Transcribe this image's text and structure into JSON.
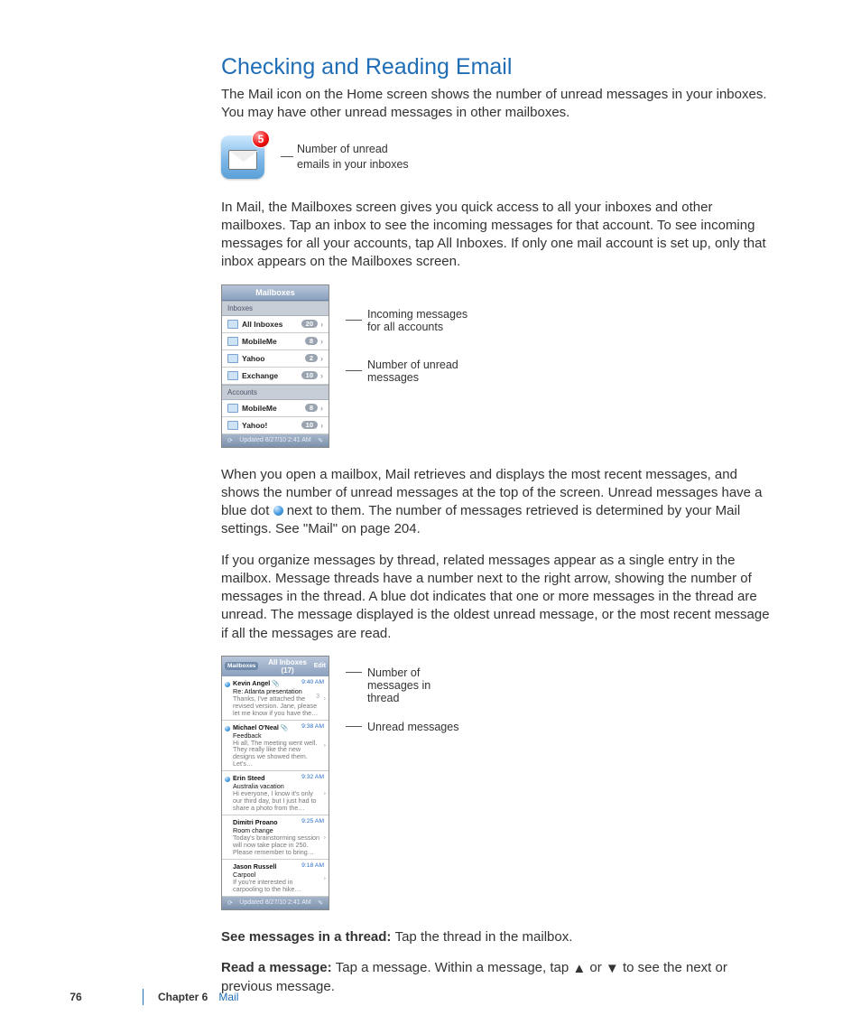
{
  "section": {
    "title": "Checking and Reading Email"
  },
  "paragraphs": {
    "p1": "The Mail icon on the Home screen shows the number of unread messages in your inboxes. You may have other unread messages in other mailboxes.",
    "iconCaption1": "Number of unread",
    "iconCaption2": "emails in your inboxes",
    "badge": "5",
    "p2": "In Mail, the Mailboxes screen gives you quick access to all your inboxes and other mailboxes. Tap an inbox to see the incoming messages for that account. To see incoming messages for all your accounts, tap All Inboxes. If only one mail account is set up, only that inbox appears on the Mailboxes screen.",
    "p3a": "When you open a mailbox, Mail retrieves and displays the most recent messages, and shows the number of unread messages at the top of the screen. Unread messages have a blue dot ",
    "p3b": " next to them. The number of messages retrieved is determined by your Mail settings. See \"Mail\" on page 204.",
    "p4": "If you organize messages by thread, related messages appear as a single entry in the mailbox. Message threads have a number next to the right arrow, showing the number of messages in the thread. A blue dot indicates that one or more messages in the thread are unread. The message displayed is the oldest unread message, or the most recent message if all the messages are read.",
    "seeThreadLabel": "See messages in a thread:  ",
    "seeThreadText": "Tap the thread in the mailbox.",
    "readLabel": "Read a message:  ",
    "readTextA": "Tap a message. Within a message, tap ",
    "readTextB": " or ",
    "readTextC": " to see the next or previous message."
  },
  "phone1": {
    "title": "Mailboxes",
    "section1": "Inboxes",
    "rows1": [
      {
        "label": "All Inboxes",
        "count": "20"
      },
      {
        "label": "MobileMe",
        "count": "8"
      },
      {
        "label": "Yahoo",
        "count": "2"
      },
      {
        "label": "Exchange",
        "count": "10"
      }
    ],
    "section2": "Accounts",
    "rows2": [
      {
        "label": "MobileMe",
        "count": "8"
      },
      {
        "label": "Yahoo!",
        "count": "10"
      }
    ],
    "updated": "Updated 8/27/10 2:41 AM",
    "callout1": "Incoming messages for all accounts",
    "callout2": "Number of unread messages"
  },
  "phone2": {
    "back": "Mailboxes",
    "title": "All Inboxes (17)",
    "edit": "Edit",
    "messages": [
      {
        "dot": true,
        "from": "Kevin Angel",
        "clip": true,
        "time": "9:40 AM",
        "subj": "Re: Atlanta presentation",
        "prev": "Thanks, I've attached the revised version. Jane, please let me know if you have the…",
        "cnt": "3"
      },
      {
        "dot": true,
        "from": "Michael O'Neal",
        "clip": true,
        "time": "9:38 AM",
        "subj": "Feedback",
        "prev": "Hi all, The meeting went well. They really like the new designs we showed them. Let's…",
        "cnt": ""
      },
      {
        "dot": true,
        "from": "Erin Steed",
        "clip": false,
        "time": "9:32 AM",
        "subj": "Australia vacation",
        "prev": "Hi everyone, I know it's only our third day, but I just had to share a photo from the…",
        "cnt": ""
      },
      {
        "dot": false,
        "from": "Dimitri Proano",
        "clip": false,
        "time": "9:25 AM",
        "subj": "Room change",
        "prev": "Today's brainstorming session will now take place in 250. Please remember to bring…",
        "cnt": ""
      },
      {
        "dot": false,
        "from": "Jason Russell",
        "clip": false,
        "time": "9:18 AM",
        "subj": "Carpool",
        "prev": "If you're interested in carpooling to the hike…",
        "cnt": ""
      }
    ],
    "updated": "Updated 8/27/10 2:41 AM",
    "callout1": "Number of messages in thread",
    "callout2": "Unread messages"
  },
  "footer": {
    "page": "76",
    "chapter": "Chapter 6",
    "name": "Mail"
  }
}
